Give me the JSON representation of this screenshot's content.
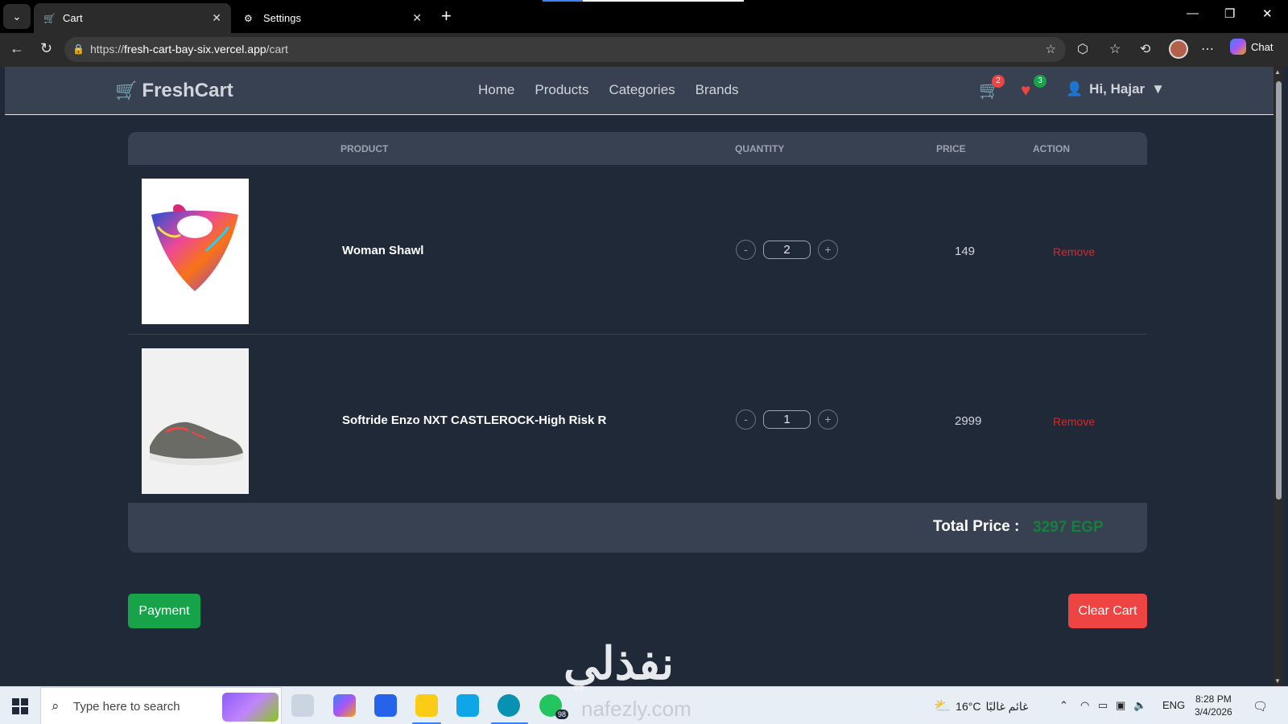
{
  "browser": {
    "tabs": [
      {
        "label": "Cart",
        "active": true
      },
      {
        "label": "Settings",
        "active": false
      }
    ],
    "url_prefix": "https://",
    "url_host": "fresh-cart-bay-six.vercel.app",
    "url_path": "/cart",
    "chat_label": "Chat"
  },
  "navbar": {
    "brand": "FreshCart",
    "links": [
      "Home",
      "Products",
      "Categories",
      "Brands"
    ],
    "cart_count": "2",
    "wishlist_count": "3",
    "user_greeting": "Hi, Hajar"
  },
  "table": {
    "headers": {
      "product": "Product",
      "quantity": "Quantity",
      "price": "Price",
      "action": "Action"
    },
    "rows": [
      {
        "name": "Woman Shawl",
        "quantity": "2",
        "price": "149",
        "action": "Remove",
        "image": "shawl"
      },
      {
        "name": "Softride Enzo NXT CASTLEROCK-High Risk R",
        "quantity": "1",
        "price": "2999",
        "action": "Remove",
        "image": "sneaker"
      }
    ],
    "decrement": "-",
    "increment": "+"
  },
  "total": {
    "label": "Total Price :",
    "value": "3297 EGP"
  },
  "actions": {
    "payment": "Payment",
    "clear_cart": "Clear Cart"
  },
  "watermark": {
    "text": "نفذلي",
    "sub": "nafezly.com"
  },
  "taskbar": {
    "search_placeholder": "Type here to search",
    "whatsapp_badge": "98",
    "weather_temp": "16°C",
    "weather_label": "غائم غالبًا",
    "language": "ENG",
    "time": "8:28 PM",
    "date": "3/4/2026"
  },
  "colors": {
    "brand_green": "#16a34a",
    "danger_red": "#ef4444",
    "page_bg": "#1f2937",
    "panel_bg": "#374151"
  }
}
